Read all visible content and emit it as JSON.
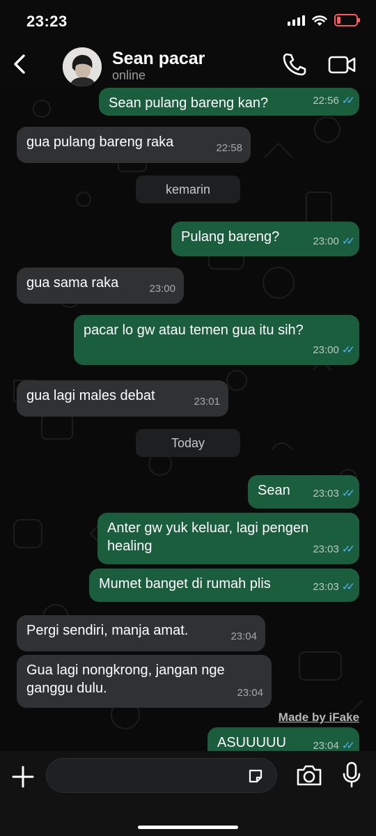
{
  "status_bar": {
    "time": "23:23"
  },
  "header": {
    "contact_name": "Sean pacar",
    "contact_status": "online"
  },
  "messages": [
    {
      "dir": "out",
      "text": "Sean pulang bareng kan?",
      "time": "22:56"
    },
    {
      "dir": "in",
      "text": "gua pulang bareng raka",
      "time": "22:58"
    },
    {
      "dir": "day",
      "text": "kemarin"
    },
    {
      "dir": "out",
      "text": "Pulang bareng?",
      "time": "23:00"
    },
    {
      "dir": "in",
      "text": "gua sama raka",
      "time": "23:00"
    },
    {
      "dir": "out",
      "text": "pacar lo gw atau temen gua itu sih?",
      "time": "23:00"
    },
    {
      "dir": "in",
      "text": "gua lagi males debat",
      "time": "23:01"
    },
    {
      "dir": "day",
      "text": "Today"
    },
    {
      "dir": "out",
      "text": "Sean",
      "time": "23:03"
    },
    {
      "dir": "out",
      "text": "Anter gw yuk keluar, lagi pengen\nhealing",
      "time": "23:03"
    },
    {
      "dir": "out",
      "text": "Mumet banget di rumah plis",
      "time": "23:03"
    },
    {
      "dir": "in",
      "text": "Pergi sendiri, manja amat.",
      "time": "23:04"
    },
    {
      "dir": "in",
      "text": "Gua lagi nongkrong, jangan nge\nganggu dulu.",
      "time": "23:04"
    },
    {
      "dir": "out",
      "text": "ASUUUUU",
      "time": "23:04"
    }
  ],
  "watermark": "Made by iFake",
  "colors": {
    "outgoing_bubble": "#1b5e3e",
    "incoming_bubble": "#2f3133",
    "read_ticks": "#4fb4ff",
    "battery": "#ff5a5f"
  }
}
